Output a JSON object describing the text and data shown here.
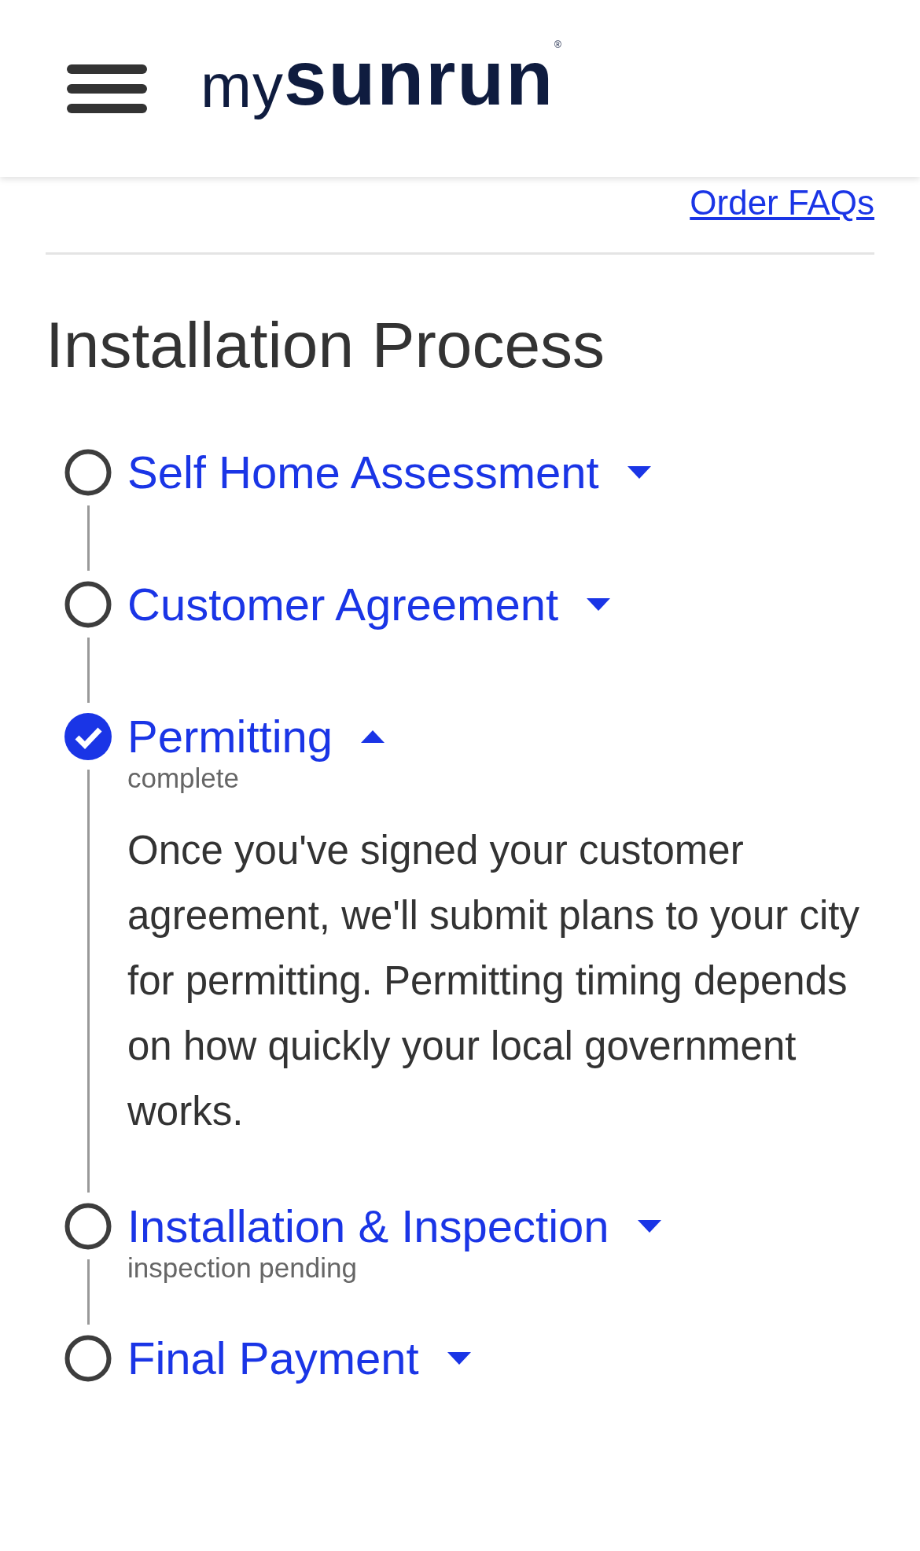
{
  "header": {
    "logo": {
      "prefix": "my",
      "name": "sunrun",
      "mark": "®"
    }
  },
  "faq_link": "Order FAQs",
  "title": "Installation Process",
  "steps": [
    {
      "title": "Self Home Assessment",
      "done": false,
      "expanded": false
    },
    {
      "title": "Customer Agreement",
      "done": false,
      "expanded": false
    },
    {
      "title": "Permitting",
      "status": "complete",
      "done": true,
      "expanded": true,
      "description": "Once you've signed your customer agreement, we'll submit plans to your city for permitting. Permitting timing depends on how quickly your local government works."
    },
    {
      "title": "Installation & Inspection",
      "status": "inspection pending",
      "done": false,
      "expanded": false
    },
    {
      "title": "Final Payment",
      "done": false,
      "expanded": false
    }
  ]
}
